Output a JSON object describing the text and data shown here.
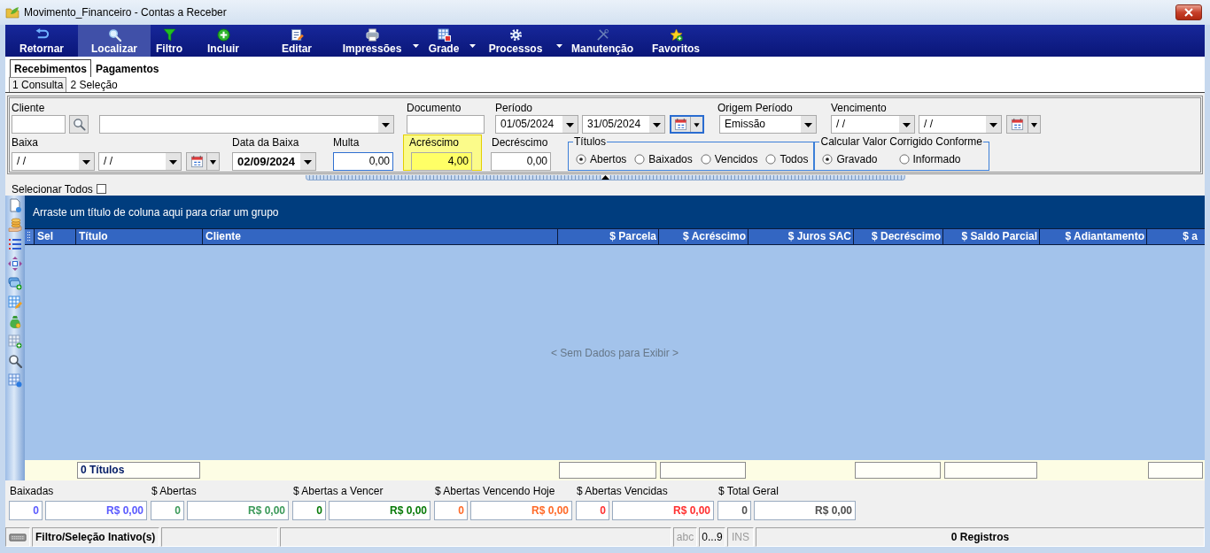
{
  "window": {
    "title": "Movimento_Financeiro - Contas a Receber"
  },
  "toolbar": [
    {
      "label": "Retornar",
      "selected": false,
      "dropdown": false
    },
    {
      "label": "Localizar",
      "selected": true,
      "dropdown": false
    },
    {
      "label": "Filtro",
      "selected": false,
      "dropdown": false
    },
    {
      "label": "Incluir",
      "selected": false,
      "dropdown": false
    },
    {
      "label": "Editar",
      "selected": false,
      "dropdown": false
    },
    {
      "label": "Impressões",
      "selected": false,
      "dropdown": true
    },
    {
      "label": "Grade",
      "selected": false,
      "dropdown": true
    },
    {
      "label": "Processos",
      "selected": false,
      "dropdown": true
    },
    {
      "label": "Manutenção",
      "selected": false,
      "dropdown": false
    },
    {
      "label": "Favoritos",
      "selected": false,
      "dropdown": false
    }
  ],
  "tabs": [
    {
      "label": "Recebimentos",
      "selected": true
    },
    {
      "label": "Pagamentos",
      "selected": false
    }
  ],
  "subtabs": [
    {
      "label": "1 Consulta",
      "selected": true
    },
    {
      "label": "2 Seleção",
      "selected": false
    }
  ],
  "filter_rows": [
    [
      {
        "kind": "field",
        "label": "Cliente",
        "highlighted": false,
        "controls": [
          {
            "kind": "text",
            "focused": false
          },
          {
            "kind": "lookup",
            "focused": false
          },
          {
            "kind": "combo",
            "focused": false
          }
        ]
      },
      {
        "kind": "field",
        "label": "Documento",
        "highlighted": false,
        "controls": [
          {
            "kind": "text",
            "focused": false
          }
        ]
      },
      {
        "kind": "field",
        "label": "Período",
        "highlighted": false,
        "controls": [
          {
            "kind": "combo",
            "value": "01/05/2024",
            "focused": false
          },
          {
            "kind": "combo",
            "value": "31/05/2024",
            "focused": false
          },
          {
            "kind": "calendar",
            "focused": true
          }
        ]
      },
      {
        "kind": "field",
        "label": "Origem Período",
        "highlighted": false,
        "controls": [
          {
            "kind": "combo",
            "value": "Emissão",
            "focused": false
          }
        ]
      },
      {
        "kind": "field",
        "label": "Vencimento",
        "highlighted": false,
        "controls": [
          {
            "kind": "combo",
            "value": "/ /",
            "focused": false
          },
          {
            "kind": "combo",
            "value": "/ /",
            "focused": false
          },
          {
            "kind": "calendar",
            "focused": false
          }
        ]
      }
    ],
    [
      {
        "kind": "field",
        "label": "Baixa",
        "highlighted": false,
        "controls": [
          {
            "kind": "combo",
            "value": "/ /",
            "focused": false
          },
          {
            "kind": "combo",
            "value": "/ /",
            "focused": false
          },
          {
            "kind": "calendar",
            "focused": false
          }
        ]
      },
      {
        "kind": "field",
        "label": "Data da Baixa",
        "highlighted": false,
        "controls": [
          {
            "kind": "combo",
            "value": "02/09/2024",
            "focused": false,
            "bold": true
          }
        ]
      },
      {
        "kind": "field",
        "label": "Multa",
        "highlighted": false,
        "controls": [
          {
            "kind": "text",
            "value": "0,00",
            "focused": true
          }
        ]
      },
      {
        "kind": "field",
        "label": "Acréscimo",
        "highlighted": true,
        "controls": [
          {
            "kind": "text",
            "value": "4,00",
            "focused": false
          }
        ]
      },
      {
        "kind": "field",
        "label": "Decréscimo",
        "highlighted": false,
        "controls": [
          {
            "kind": "text",
            "value": "0,00",
            "focused": false
          }
        ]
      },
      {
        "kind": "radio-group",
        "label": "Títulos",
        "highlighted": false,
        "options": [
          {
            "label": "Abertos",
            "selected": true
          },
          {
            "label": "Baixados",
            "selected": false
          },
          {
            "label": "Vencidos",
            "selected": false
          },
          {
            "label": "Todos",
            "selected": false
          }
        ]
      },
      {
        "kind": "radio-group",
        "label": "Calcular Valor Corrigido Conforme",
        "highlighted": false,
        "options": [
          {
            "label": "Gravado",
            "selected": true
          },
          {
            "label": "Informado",
            "selected": false
          }
        ]
      }
    ]
  ],
  "select_all": {
    "label": "Selecionar Todos",
    "checked": false
  },
  "grid": {
    "group_hint": "Arraste um título de coluna aqui para criar um grupo",
    "columns": [
      {
        "label": "Sel",
        "kind": "text",
        "summary": false
      },
      {
        "label": "Título",
        "kind": "text",
        "summary": true,
        "footer": "0 Títulos"
      },
      {
        "label": "Cliente",
        "kind": "text",
        "summary": false
      },
      {
        "label": "$ Parcela",
        "kind": "money",
        "summary": true
      },
      {
        "label": "$ Acréscimo",
        "kind": "money",
        "summary": true
      },
      {
        "label": "$ Juros SAC",
        "kind": "money",
        "summary": false
      },
      {
        "label": "$ Decréscimo",
        "kind": "money",
        "summary": true
      },
      {
        "label": "$ Saldo Parcial",
        "kind": "money",
        "summary": true
      },
      {
        "label": "$ Adiantamento",
        "kind": "money",
        "summary": false
      },
      {
        "label": "$ a",
        "kind": "money",
        "summary": true
      }
    ],
    "empty_text": "< Sem Dados para Exibir >"
  },
  "totals": [
    {
      "label": "Baixadas",
      "count": "0",
      "amount": "R$ 0,00",
      "color": "#5a5aff"
    },
    {
      "label": "$ Abertas",
      "count": "0",
      "amount": "R$ 0,00",
      "color": "#3c9a5a"
    },
    {
      "label": "$ Abertas a Vencer",
      "count": "0",
      "amount": "R$ 0,00",
      "color": "#087a08"
    },
    {
      "label": "$ Abertas Vencendo Hoje",
      "count": "0",
      "amount": "R$ 0,00",
      "color": "#ff6a28"
    },
    {
      "label": "$ Abertas Vencidas",
      "count": "0",
      "amount": "R$ 0,00",
      "color": "#ff3030"
    },
    {
      "label": "$ Total Geral",
      "count": "0",
      "amount": "R$ 0,00",
      "color": "#505050"
    }
  ],
  "status_bar": {
    "filter_status": "Filtro/Seleção Inativo(s)",
    "indicators": [
      {
        "label": "abc",
        "disabled": true
      },
      {
        "label": "0...9",
        "disabled": false
      },
      {
        "label": "INS",
        "disabled": true
      }
    ],
    "record_count": "0 Registros"
  }
}
